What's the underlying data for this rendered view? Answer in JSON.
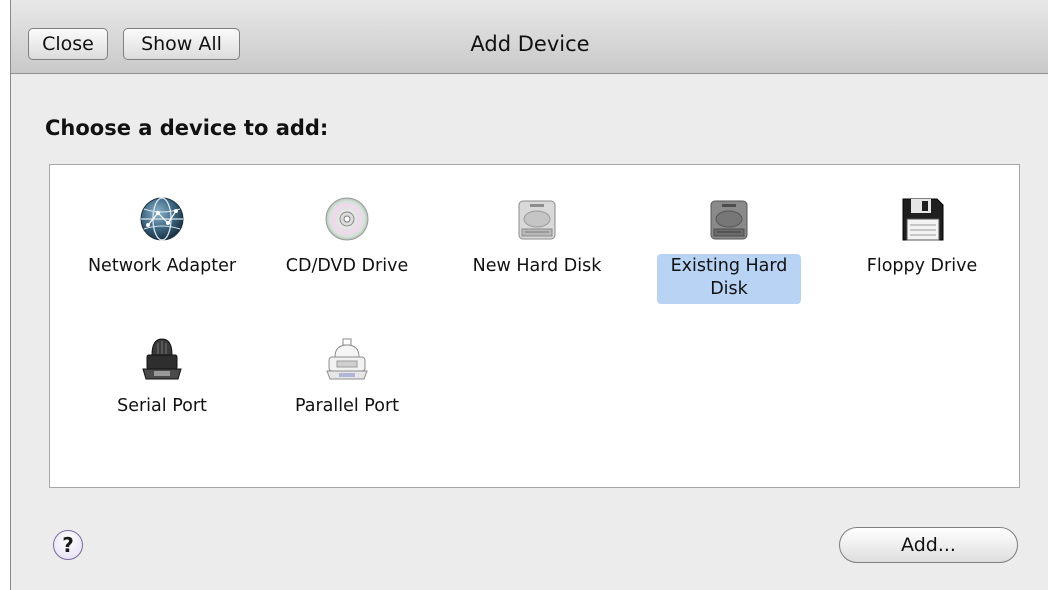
{
  "window": {
    "title": "Add Device",
    "toolbar": {
      "close_label": "Close",
      "show_all_label": "Show All"
    }
  },
  "prompt": "Choose a device to add:",
  "devices": [
    {
      "label": "Network Adapter",
      "icon": "network-globe-icon",
      "selected": false
    },
    {
      "label": "CD/DVD Drive",
      "icon": "cd-dvd-disc-icon",
      "selected": false
    },
    {
      "label": "New Hard Disk",
      "icon": "hard-disk-icon",
      "selected": false
    },
    {
      "label": "Existing Hard Disk",
      "icon": "hard-disk-dark-icon",
      "selected": true
    },
    {
      "label": "Floppy Drive",
      "icon": "floppy-disk-icon",
      "selected": false
    },
    {
      "label": "Serial Port",
      "icon": "serial-port-icon",
      "selected": false
    },
    {
      "label": "Parallel Port",
      "icon": "parallel-port-icon",
      "selected": false
    }
  ],
  "footer": {
    "help_symbol": "?",
    "add_label": "Add..."
  },
  "colors": {
    "selection": "#b9d3f5",
    "window_bg": "#ececec"
  }
}
